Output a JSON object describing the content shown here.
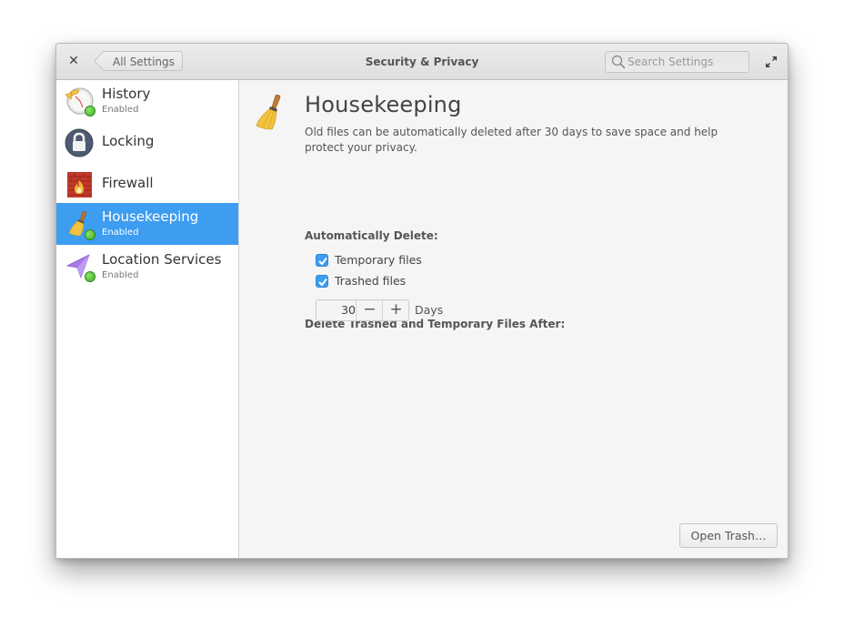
{
  "window": {
    "title": "Security & Privacy",
    "close_icon": "close-icon",
    "back_button_label": "All Settings",
    "search_placeholder": "Search Settings",
    "maximize_icon": "maximize-icon"
  },
  "sidebar": {
    "items": [
      {
        "label": "History",
        "status": "Enabled",
        "icon": "history-clock-icon",
        "selected": false
      },
      {
        "label": "Locking",
        "status": "",
        "icon": "lock-icon",
        "selected": false
      },
      {
        "label": "Firewall",
        "status": "",
        "icon": "firewall-icon",
        "selected": false
      },
      {
        "label": "Housekeeping",
        "status": "Enabled",
        "icon": "broom-icon",
        "selected": true
      },
      {
        "label": "Location Services",
        "status": "Enabled",
        "icon": "location-arrow-icon",
        "selected": false
      }
    ]
  },
  "page": {
    "title": "Housekeeping",
    "icon": "broom-icon",
    "description": "Old files can be automatically deleted after 30 days to save space and help protect your privacy.",
    "auto_delete_label": "Automatically Delete:",
    "checkboxes": [
      {
        "label": "Temporary files",
        "checked": true
      },
      {
        "label": "Trashed files",
        "checked": true
      }
    ],
    "delete_after_label": "Delete Trashed and Temporary Files After:",
    "days_value": "30",
    "minus_label": "−",
    "plus_label": "+",
    "days_unit": "Days",
    "open_trash_label": "Open Trash…"
  },
  "colors": {
    "accent": "#3d9df0",
    "status_enabled": "#4cbb2c"
  }
}
